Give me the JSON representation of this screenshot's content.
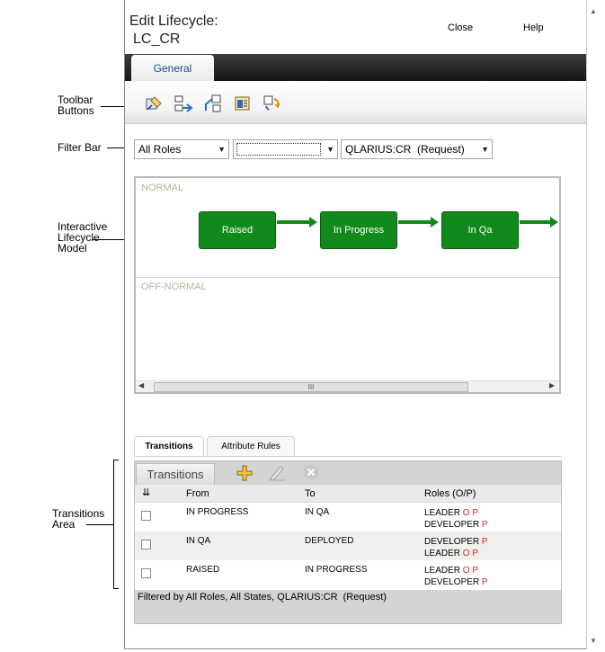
{
  "annotations": {
    "toolbar": "Toolbar\nButtons",
    "filter_bar": "Filter Bar",
    "model": "Interactive\nLifecycle\nModel",
    "transitions": "Transitions\nArea"
  },
  "window": {
    "title_line1": "Edit Lifecycle:",
    "title_line2": "LC_CR",
    "close_label": "Close",
    "help_label": "Help"
  },
  "tabs": {
    "general": "General"
  },
  "toolbar": {
    "buttons": [
      "edit-state-icon",
      "add-transition-icon",
      "add-state-icon",
      "properties-icon",
      "refresh-icon"
    ]
  },
  "filter": {
    "roles": "All Roles",
    "states": "",
    "type": "QLARIUS:CR  (Request)"
  },
  "model": {
    "lane_normal": "NORMAL",
    "lane_off_normal": "OFF-NORMAL",
    "states": [
      "Raised",
      "In Progress",
      "In Qa"
    ],
    "scroll_thumb": "III"
  },
  "bottom_tabs": {
    "transitions": "Transitions",
    "attribute_rules": "Attribute Rules"
  },
  "transitions": {
    "panel_title": "Transitions",
    "columns": {
      "from": "From",
      "to": "To",
      "roles": "Roles (O/P)"
    },
    "rows": [
      {
        "from": "IN PROGRESS",
        "to": "IN QA",
        "roles": [
          {
            "name": "LEADER",
            "flag": "O P"
          },
          {
            "name": "DEVELOPER",
            "flag": "P"
          }
        ]
      },
      {
        "from": "IN QA",
        "to": "DEPLOYED",
        "roles": [
          {
            "name": "DEVELOPER",
            "flag": "P"
          },
          {
            "name": "LEADER",
            "flag": "O P"
          }
        ]
      },
      {
        "from": "RAISED",
        "to": "IN PROGRESS",
        "roles": [
          {
            "name": "LEADER",
            "flag": "O P"
          },
          {
            "name": "DEVELOPER",
            "flag": "P"
          }
        ]
      }
    ],
    "filter_text": "Filtered by All Roles, All States, QLARIUS:CR  (Request)"
  },
  "colors": {
    "state_green": "#118a1b",
    "role_flag_red": "#e02020",
    "tab_blue": "#1b4f8a"
  }
}
